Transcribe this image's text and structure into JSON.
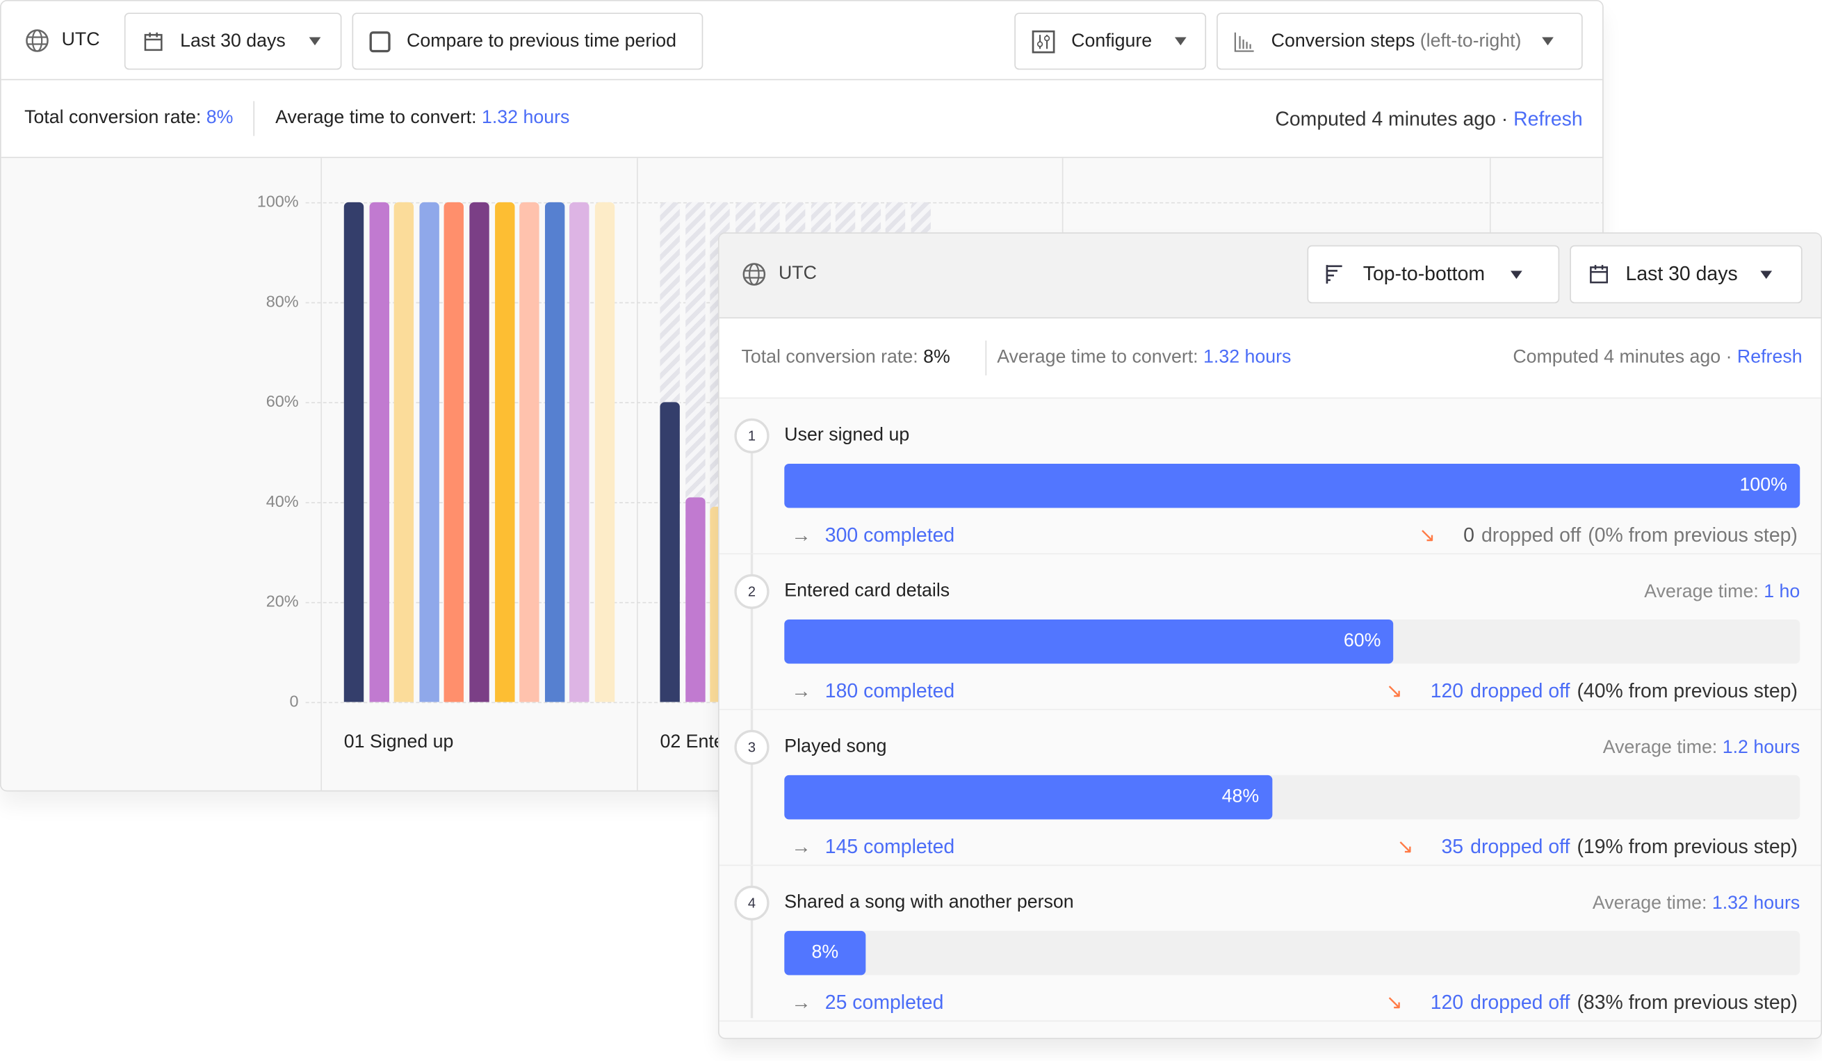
{
  "back_panel": {
    "timezone": "UTC",
    "date_range": "Last 30 days",
    "compare_label": "Compare to previous time period",
    "configure_label": "Configure",
    "view_label": "Conversion steps",
    "view_sub": "(left-to-right)",
    "stats": {
      "total_label": "Total conversion rate:",
      "total_value": "8%",
      "avg_label": "Average time to convert:",
      "avg_value": "1.32 hours",
      "computed": "Computed 4 minutes ago ·",
      "refresh": "Refresh"
    }
  },
  "chart_data": {
    "type": "bar",
    "ylim": [
      0,
      100
    ],
    "yticks": [
      "100%",
      "80%",
      "60%",
      "40%",
      "20%",
      "0"
    ],
    "categories": [
      "01 Signed up",
      "02 Ente"
    ],
    "grid": true,
    "colors": [
      "#343e6b",
      "#c17ad0",
      "#fbdc9a",
      "#8fa8ea",
      "#ff8f6c",
      "#7b3f86",
      "#fdbe33",
      "#ffc2ad",
      "#5680d0",
      "#ddb4e4",
      "#fdecc8"
    ],
    "groups": [
      {
        "values": [
          100,
          100,
          100,
          100,
          100,
          100,
          100,
          100,
          100,
          100,
          100
        ]
      },
      {
        "values": [
          60,
          41,
          39
        ]
      }
    ]
  },
  "front_panel": {
    "timezone": "UTC",
    "orientation": "Top-to-bottom",
    "date_range": "Last 30 days",
    "stats": {
      "total_label": "Total conversion rate:",
      "total_value": "8%",
      "avg_label": "Average time to convert:",
      "avg_value": "1.32 hours",
      "computed": "Computed 4 minutes ago ·",
      "refresh": "Refresh"
    },
    "accent": "#5276ff",
    "steps": [
      {
        "num": "1",
        "title": "User signed up",
        "avg_label": "",
        "avg_value": "",
        "percent": 100,
        "percent_label": "100%",
        "completed": "300 completed",
        "dropped": "0",
        "dropped_label": "dropped off",
        "dropped_detail": "(0% from previous step)"
      },
      {
        "num": "2",
        "title": "Entered card details",
        "avg_label": "Average time:",
        "avg_value": "1 ho",
        "percent": 60,
        "percent_label": "60%",
        "completed": "180 completed",
        "dropped": "120",
        "dropped_label": "dropped off",
        "dropped_detail": "(40% from previous step)"
      },
      {
        "num": "3",
        "title": "Played song",
        "avg_label": "Average time:",
        "avg_value": "1.2 hours",
        "percent": 48,
        "percent_label": "48%",
        "completed": "145 completed",
        "dropped": "35",
        "dropped_label": "dropped off",
        "dropped_detail": "(19% from previous step)"
      },
      {
        "num": "4",
        "title": "Shared a song with another person",
        "avg_label": "Average time:",
        "avg_value": "1.32 hours",
        "percent": 8,
        "percent_label": "8%",
        "completed": "25 completed",
        "dropped": "120",
        "dropped_label": "dropped off",
        "dropped_detail": "(83% from previous step)"
      }
    ]
  }
}
